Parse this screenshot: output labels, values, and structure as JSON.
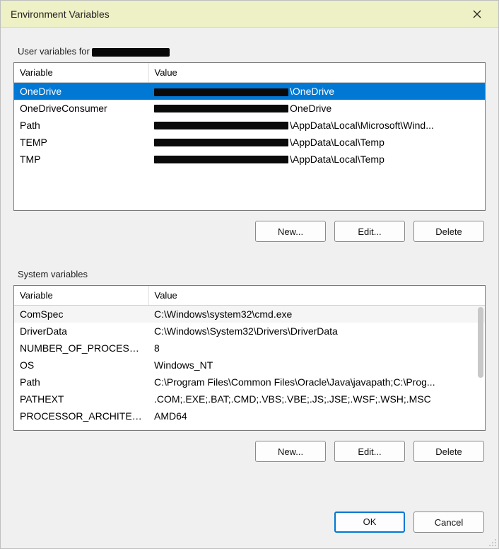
{
  "title": "Environment Variables",
  "user_section": {
    "label_prefix": "User variables for ",
    "columns": {
      "variable": "Variable",
      "value": "Value"
    },
    "rows": [
      {
        "variable": "OneDrive",
        "value_suffix": "\\OneDrive",
        "selected": true
      },
      {
        "variable": "OneDriveConsumer",
        "value_suffix": "OneDrive"
      },
      {
        "variable": "Path",
        "value_suffix": "\\AppData\\Local\\Microsoft\\Wind..."
      },
      {
        "variable": "TEMP",
        "value_suffix": "\\AppData\\Local\\Temp"
      },
      {
        "variable": "TMP",
        "value_suffix": "\\AppData\\Local\\Temp"
      }
    ],
    "buttons": {
      "new": "New...",
      "edit": "Edit...",
      "delete": "Delete"
    }
  },
  "system_section": {
    "label": "System variables",
    "columns": {
      "variable": "Variable",
      "value": "Value"
    },
    "rows": [
      {
        "variable": "ComSpec",
        "value": "C:\\Windows\\system32\\cmd.exe"
      },
      {
        "variable": "DriverData",
        "value": "C:\\Windows\\System32\\Drivers\\DriverData"
      },
      {
        "variable": "NUMBER_OF_PROCESSORS",
        "value": "8"
      },
      {
        "variable": "OS",
        "value": "Windows_NT"
      },
      {
        "variable": "Path",
        "value": "C:\\Program Files\\Common Files\\Oracle\\Java\\javapath;C:\\Prog..."
      },
      {
        "variable": "PATHEXT",
        "value": ".COM;.EXE;.BAT;.CMD;.VBS;.VBE;.JS;.JSE;.WSF;.WSH;.MSC"
      },
      {
        "variable": "PROCESSOR_ARCHITECTU...",
        "value": "AMD64"
      }
    ],
    "buttons": {
      "new": "New...",
      "edit": "Edit...",
      "delete": "Delete"
    }
  },
  "dialog_buttons": {
    "ok": "OK",
    "cancel": "Cancel"
  }
}
